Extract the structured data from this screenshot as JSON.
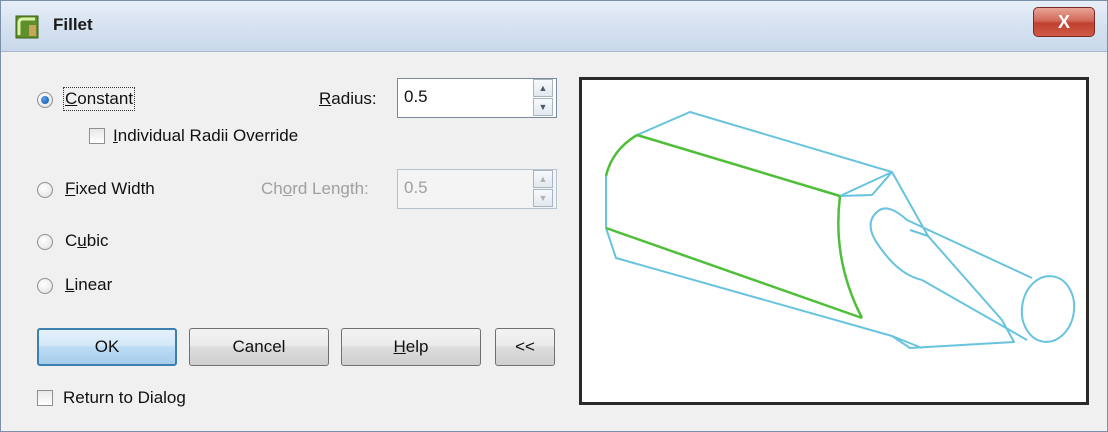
{
  "window": {
    "title": "Fillet",
    "close_glyph": "X",
    "icon": "app-icon"
  },
  "options": {
    "constant": {
      "label_prefix": "",
      "label_mnemonic": "C",
      "label_rest": "onstant",
      "checked": true
    },
    "individual_radii": {
      "label_prefix": "",
      "label_mnemonic": "I",
      "label_rest": "ndividual Radii Override",
      "checked": false
    },
    "fixed_width": {
      "label_prefix": "",
      "label_mnemonic": "F",
      "label_rest": "ixed Width",
      "checked": false
    },
    "cubic": {
      "label_prefix": "C",
      "label_mnemonic": "u",
      "label_rest": "bic",
      "checked": false
    },
    "linear": {
      "label_prefix": "",
      "label_mnemonic": "L",
      "label_rest": "inear",
      "checked": false
    }
  },
  "radius": {
    "label_mnemonic": "R",
    "label_rest": "adius:",
    "value": "0.5"
  },
  "chord_length": {
    "label_prefix": "Ch",
    "label_mnemonic": "o",
    "label_rest": "rd Length:",
    "value": "0.5",
    "enabled": false
  },
  "buttons": {
    "ok": "OK",
    "cancel": "Cancel",
    "help_mnemonic": "H",
    "help_rest": "elp",
    "collapse": "<<"
  },
  "return_to_dialog": {
    "label": "Return to Dialog",
    "checked": false
  },
  "preview": {
    "icon": "fillet-preview-image",
    "fillet_color": "#4fbf3a",
    "edge_color": "#67c3de"
  }
}
